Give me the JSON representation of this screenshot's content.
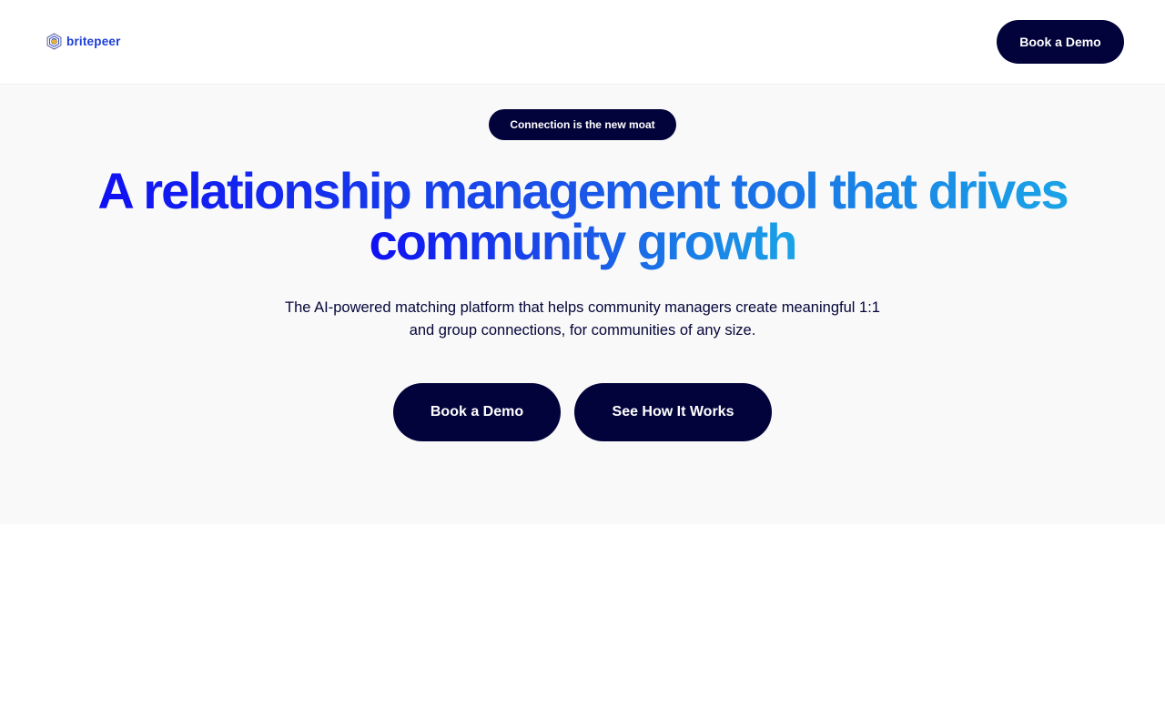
{
  "header": {
    "logo_icon": "hexagon-shield-logo-icon",
    "logo_text": "britepeer",
    "book_demo_label": "Book a Demo"
  },
  "hero": {
    "badge": "Connection is the new moat",
    "headline_line1": "A relationship management tool that drives",
    "headline_line2": "community growth",
    "subtext_line1": "The AI-powered matching platform that helps community managers create meaningful 1:1",
    "subtext_line2": "and group connections, for communities of any size.",
    "cta_primary": "Book a Demo",
    "cta_secondary": "See How It Works"
  },
  "colors": {
    "navy": "#03033c",
    "brand_blue": "#1b3ed6",
    "gradient_start": "#1010f3",
    "gradient_end": "#1aa3e6",
    "hero_background": "#f9f9f9"
  }
}
